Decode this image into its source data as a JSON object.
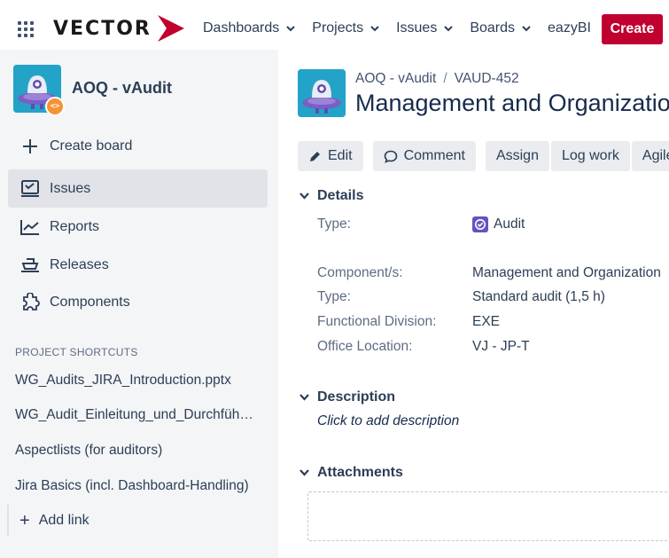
{
  "topbar": {
    "logo_text": "VECTOR",
    "nav": [
      {
        "label": "Dashboards",
        "has_menu": true
      },
      {
        "label": "Projects",
        "has_menu": true
      },
      {
        "label": "Issues",
        "has_menu": true
      },
      {
        "label": "Boards",
        "has_menu": true
      },
      {
        "label": "eazyBI",
        "has_menu": false
      }
    ],
    "create_label": "Create",
    "brand_red": "#c0002f"
  },
  "sidebar": {
    "project_name": "AOQ - vAudit",
    "items": [
      {
        "label": "Create board",
        "icon": "plus-icon",
        "active": false
      },
      {
        "label": "Issues",
        "icon": "issues-icon",
        "active": true
      },
      {
        "label": "Reports",
        "icon": "reports-icon",
        "active": false
      },
      {
        "label": "Releases",
        "icon": "releases-icon",
        "active": false
      },
      {
        "label": "Components",
        "icon": "components-icon",
        "active": false
      }
    ],
    "shortcuts_heading": "PROJECT SHORTCUTS",
    "shortcuts": [
      "WG_Audits_JIRA_Introduction.pptx",
      "WG_Audit_Einleitung_und_Durchführung",
      "Aspectlists (for auditors)",
      "Jira Basics (incl. Dashboard-Handling)"
    ],
    "add_link_label": "Add link"
  },
  "issue": {
    "breadcrumb_project": "AOQ - vAudit",
    "breadcrumb_separator": "/",
    "key": "VAUD-452",
    "summary": "Management and Organization",
    "actions": [
      {
        "label": "Edit",
        "icon": "pencil-icon"
      },
      {
        "label": "Comment",
        "icon": "comment-icon"
      },
      {
        "label": "Assign",
        "icon": ""
      },
      {
        "label": "Log work",
        "icon": ""
      },
      {
        "label": "Agile",
        "icon": ""
      }
    ],
    "details_heading": "Details",
    "type_label": "Type:",
    "type_value": "Audit",
    "fields": [
      {
        "label": "Component/s:",
        "value": "Management and Organization"
      },
      {
        "label": "Type:",
        "value": "Standard audit (1,5 h)"
      },
      {
        "label": "Functional Division:",
        "value": "EXE"
      },
      {
        "label": "Office Location:",
        "value": "VJ - JP-T"
      }
    ],
    "description_heading": "Description",
    "description_placeholder": "Click to add description",
    "attachments_heading": "Attachments"
  }
}
